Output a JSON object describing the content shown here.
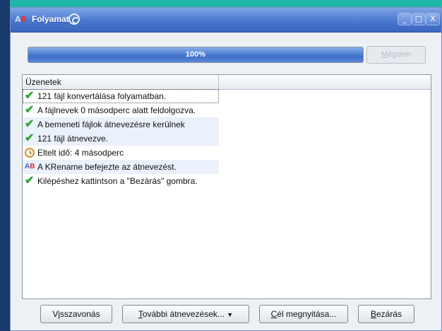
{
  "window": {
    "title": "Folyamat",
    "minimize": "_",
    "maximize": "□",
    "close": "X"
  },
  "progress": {
    "value_percent": 100,
    "label": "100%"
  },
  "cancel_button": {
    "label_underlined": "M",
    "label_rest": "égsem",
    "enabled": false
  },
  "list": {
    "column_header": "Üzenetek",
    "rows": [
      {
        "icon": "check-icon",
        "text": "121 fájl konvertálása folyamatban."
      },
      {
        "icon": "check-icon",
        "text": "A fájlnevek 0 másodperc alatt feldolgozva."
      },
      {
        "icon": "check-icon",
        "text": "A bemeneti fájlok átnevezésre kerülnek"
      },
      {
        "icon": "check-icon",
        "text": "121 fájl átnevezve."
      },
      {
        "icon": "clock-icon",
        "text": "Eltelt idő: 4 másodperc"
      },
      {
        "icon": "krename-icon",
        "text": "A KRename befejezte az átnevezést."
      },
      {
        "icon": "check-icon",
        "text": "Kilépéshez kattintson a \"Bezárás\" gombra."
      }
    ]
  },
  "buttons": {
    "undo": {
      "pre": "V",
      "u": "i",
      "post": "sszavonás"
    },
    "more": {
      "u": "T",
      "post": "ovábbi átnevezések...",
      "arrow": "▼"
    },
    "open": {
      "u": "C",
      "post": "él megnyitása..."
    },
    "close": {
      "u": "B",
      "post": "ezárás"
    }
  },
  "colors": {
    "desktop": "#1fb5a8",
    "titlebar": "#4a78cf",
    "progress": "#3e6ec7",
    "check": "#2fa62f"
  }
}
